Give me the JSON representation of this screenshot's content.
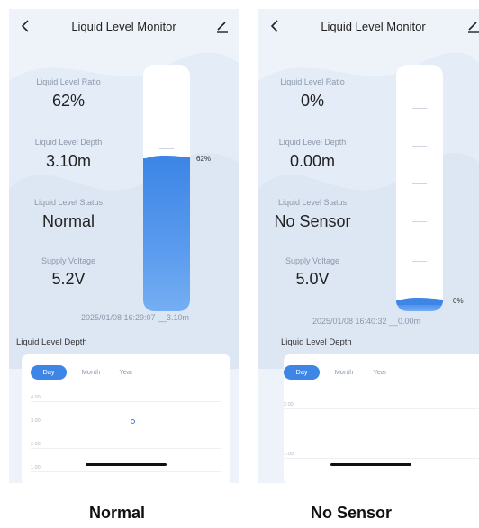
{
  "normal": {
    "title": "Liquid Level Monitor",
    "ratio_label": "Liquid Level Ratio",
    "ratio_value": "62%",
    "depth_label": "Liquid Level Depth",
    "depth_value": "3.10m",
    "status_label": "Liquid Level Status",
    "status_value": "Normal",
    "voltage_label": "Supply Voltage",
    "voltage_value": "5.2V",
    "tank_level": 0.62,
    "tank_percent_label": "62%",
    "timestamp": "2025/01/08 16:29:07 __3.10m",
    "section_title": "Liquid Level Depth",
    "tabs": [
      "Day",
      "Month",
      "Year"
    ],
    "grid_labels": [
      "4.00",
      "3.00",
      "2.00",
      "1.00"
    ],
    "caption": "Normal"
  },
  "nosensor": {
    "title": "Liquid Level Monitor",
    "ratio_label": "Liquid Level Ratio",
    "ratio_value": "0%",
    "depth_label": "Liquid Level Depth",
    "depth_value": "0.00m",
    "status_label": "Liquid Level Status",
    "status_value": "No Sensor",
    "voltage_label": "Supply Voltage",
    "voltage_value": "5.0V",
    "tank_level": 0.0,
    "tank_percent_label": "0%",
    "timestamp": "2025/01/08 16:40:32 __0.00m",
    "section_title": "Liquid Level Depth",
    "tabs": [
      "Day",
      "Month",
      "Year"
    ],
    "grid_labels": [
      "2.00",
      "1.00"
    ],
    "caption": "No Sensor"
  },
  "colors": {
    "accent": "#3d86e6",
    "background": "#eef3fa"
  },
  "icons": {
    "back": "chevron-left-icon",
    "edit": "pencil-icon"
  }
}
